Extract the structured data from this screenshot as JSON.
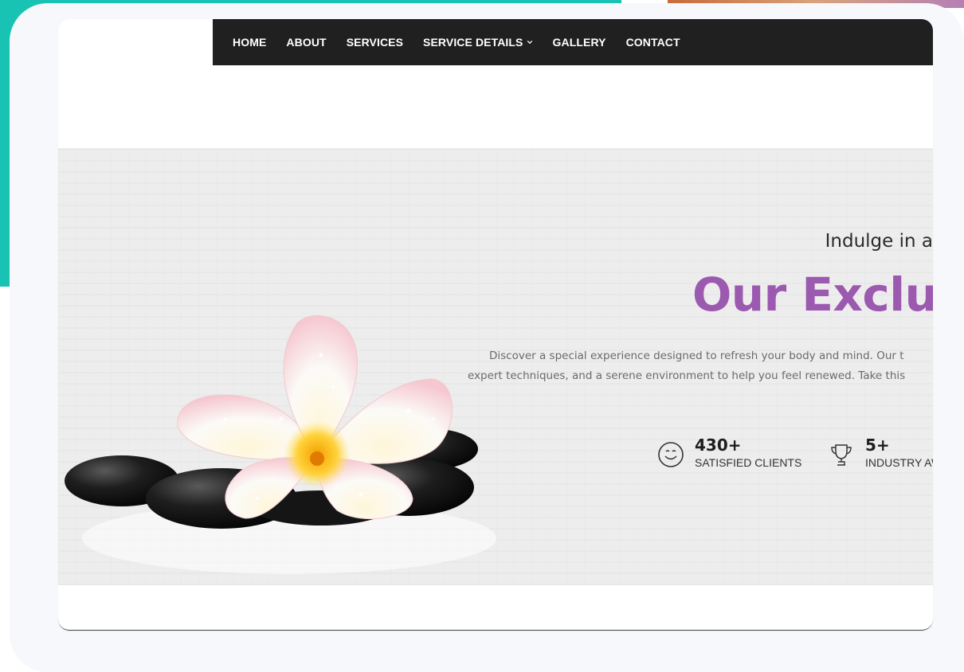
{
  "nav": {
    "items": [
      {
        "label": "HOME"
      },
      {
        "label": "ABOUT"
      },
      {
        "label": "SERVICES"
      },
      {
        "label": "SERVICE DETAILS",
        "has_dropdown": true
      },
      {
        "label": "GALLERY"
      },
      {
        "label": "CONTACT"
      }
    ]
  },
  "hero": {
    "tagline": "Indulge in a",
    "title": "Our Exclusi",
    "description_line1": "Discover a special experience designed to refresh your body and mind. Our t",
    "description_line2": "expert techniques, and a serene environment to help you feel renewed. Take this",
    "image_alt": "spa-flower-stones-icon",
    "stats": [
      {
        "value": "430+",
        "label": "SATISFIED CLIENTS",
        "icon": "smiley-icon"
      },
      {
        "value": "5+",
        "label": "INDUSTRY AW",
        "icon": "trophy-icon"
      }
    ]
  },
  "colors": {
    "accent": "#9b59b0",
    "nav_bg": "#202020",
    "teal": "#19c3b3",
    "hero_bg": "#ededed"
  }
}
